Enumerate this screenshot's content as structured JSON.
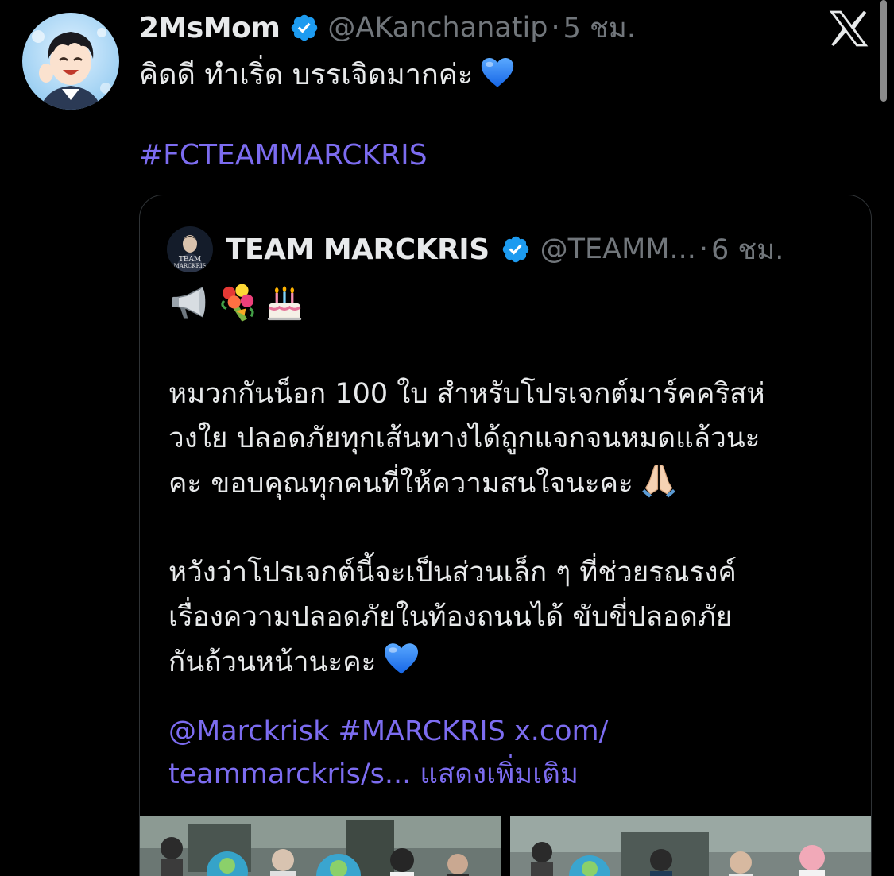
{
  "post": {
    "display_name": "2MsMom",
    "handle": "@AKanchanatip",
    "separator": "·",
    "time": "5 ชม.",
    "text": "คิดดี ทำเริ่ด บรรเจิดมากค่ะ",
    "hashtag": "#FCTEAMMARCKRIS"
  },
  "quote": {
    "display_name": "TEAM MARCKRIS",
    "handle": "@TEAMM...",
    "separator": "·",
    "time": "6 ชม.",
    "avatar_text_1": "TEAM",
    "avatar_text_2": "MARCKRIS",
    "emojis": [
      "megaphone-icon",
      "bouquet-icon",
      "birthday-cake-icon"
    ],
    "paragraph_1": [
      "หมวกกันน็อก 100 ใบ สำหรับโปรเจกต์มาร์คคริสห่",
      "วงใย ปลอดภัยทุกเส้นทางได้ถูกแจกจนหมดแล้วนะ",
      "คะ ขอบคุณทุกคนที่ให้ความสนใจนะคะ"
    ],
    "paragraph_2": [
      "หวังว่าโปรเจกต์นี้จะเป็นส่วนเล็ก ๆ ที่ช่วยรณรงค์",
      "เรื่องความปลอดภัยในท้องถนนได้ ขับขี่ปลอดภัย",
      "กันถ้วนหน้านะคะ"
    ],
    "mention": "@Marckrisk",
    "quote_hashtag": "#MARCKRIS",
    "link_1": "x.com/",
    "link_2": "teammarckris/s...",
    "show_more": "แสดงเพิ่มเติม"
  },
  "colors": {
    "background": "#000000",
    "text": "#e7e9ea",
    "muted": "#71767b",
    "link": "#7c6cf0",
    "verified": "#1d9bf0",
    "border": "#2f3336"
  },
  "icons": {
    "verified": "verified-badge-icon",
    "x_logo": "x-logo-icon",
    "heart": "blue-heart-icon",
    "pray": "folded-hands-icon"
  }
}
